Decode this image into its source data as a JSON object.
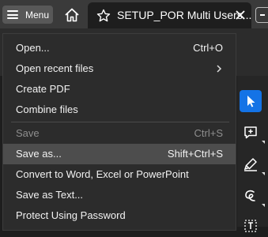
{
  "topbar": {
    "menu_label": "Menu",
    "tab_title": "SETUP_POR Multi Users..."
  },
  "menu": {
    "items": [
      {
        "label": "Open...",
        "shortcut": "Ctrl+O",
        "enabled": true
      },
      {
        "label": "Open recent files",
        "shortcut": "",
        "submenu": true,
        "enabled": true
      },
      {
        "label": "Create PDF",
        "shortcut": "",
        "enabled": true
      },
      {
        "label": "Combine files",
        "shortcut": "",
        "enabled": true
      },
      {
        "label": "Save",
        "shortcut": "Ctrl+S",
        "enabled": false
      },
      {
        "label": "Save as...",
        "shortcut": "Shift+Ctrl+S",
        "enabled": true,
        "highlighted": true
      },
      {
        "label": "Convert to Word, Excel or PowerPoint",
        "shortcut": "",
        "enabled": true
      },
      {
        "label": "Save as Text...",
        "shortcut": "",
        "enabled": true
      },
      {
        "label": "Protect Using Password",
        "shortcut": "",
        "enabled": true
      }
    ]
  },
  "toolbar": {
    "tools": [
      "select-tool-icon",
      "add-comment-icon",
      "highlight-pen-icon",
      "draw-freeform-icon",
      "text-select-icon"
    ],
    "active": "select-tool-icon"
  },
  "colors": {
    "accent": "#1473e6",
    "menu_bg": "#2c2c2c",
    "highlight_bg": "#4d4d4d"
  }
}
